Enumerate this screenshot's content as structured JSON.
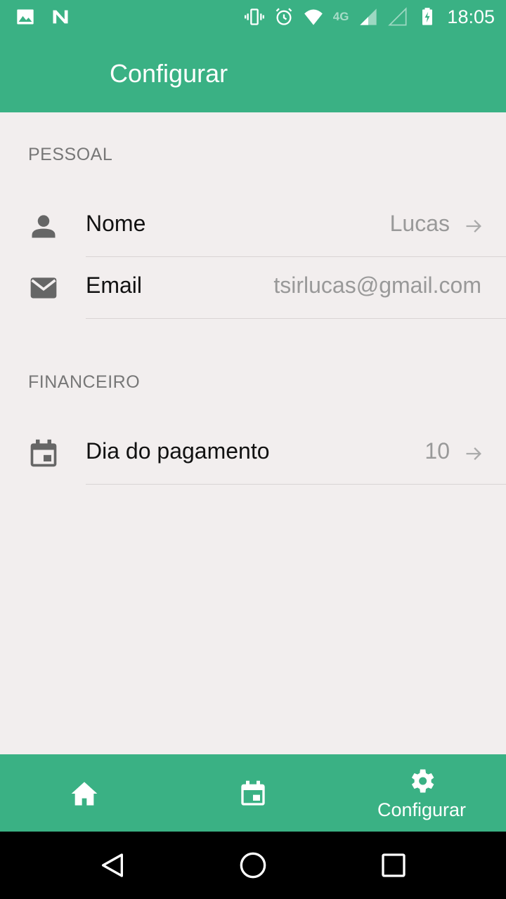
{
  "status_bar": {
    "time": "18:05",
    "network_type": "4G",
    "left_icons": [
      "image-icon",
      "n-icon"
    ],
    "right_icons": [
      "vibrate-icon",
      "alarm-icon",
      "wifi-icon",
      "signal-icon",
      "signal-icon",
      "battery-charging-icon"
    ]
  },
  "app_bar": {
    "title": "Configurar"
  },
  "sections": [
    {
      "header": "PESSOAL",
      "items": [
        {
          "label": "Nome",
          "value": "Lucas",
          "icon": "person-icon",
          "has_arrow": true
        },
        {
          "label": "Email",
          "value": "tsirlucas@gmail.com",
          "icon": "email-icon",
          "has_arrow": false
        }
      ]
    },
    {
      "header": "FINANCEIRO",
      "items": [
        {
          "label": "Dia do pagamento",
          "value": "10",
          "icon": "calendar-icon",
          "has_arrow": true
        }
      ]
    }
  ],
  "bottom_nav": {
    "items": [
      {
        "icon": "home-icon",
        "label": ""
      },
      {
        "icon": "calendar-icon",
        "label": ""
      },
      {
        "icon": "gear-icon",
        "label": "Configurar",
        "active": true
      }
    ]
  },
  "system_nav": [
    "back-icon",
    "home-circle-icon",
    "recents-icon"
  ],
  "colors": {
    "primary": "#3ab184",
    "background": "#f2eeee",
    "section_header": "#777777",
    "value_text": "#999999"
  }
}
